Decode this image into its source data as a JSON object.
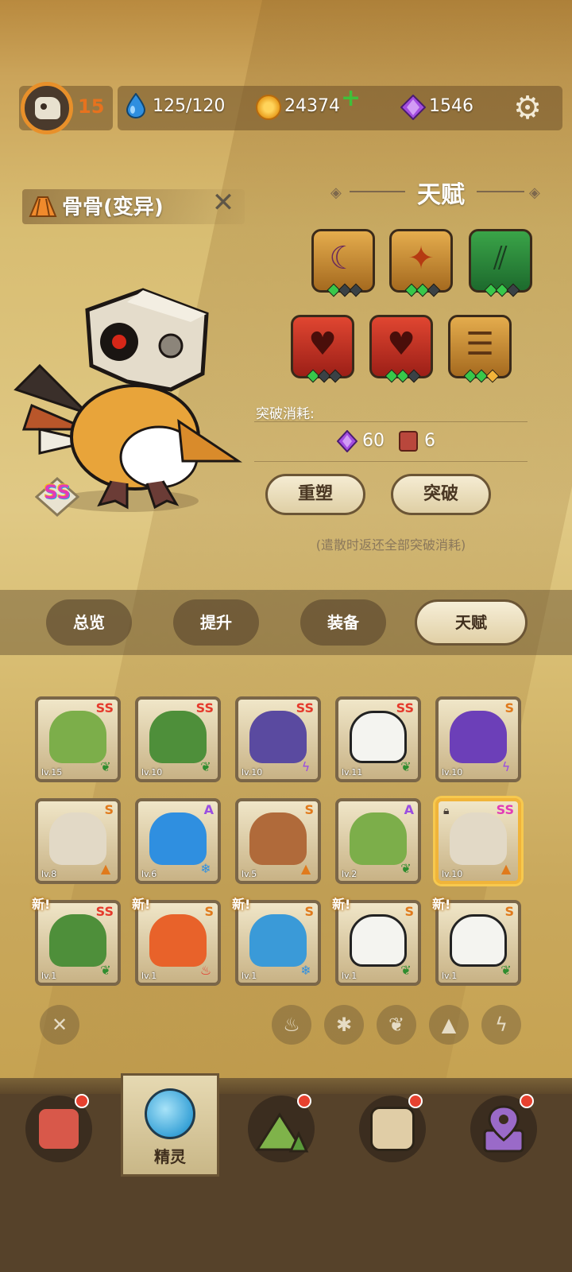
{
  "top_bar": {
    "player_level": "15",
    "energy": "125/120",
    "coins": "24374",
    "gems": "1546"
  },
  "pet": {
    "name": "骨骨(变异)",
    "grade": "SS"
  },
  "talent": {
    "title": "天赋",
    "skills": [
      {
        "color": "gold",
        "icon": "crescent-icon",
        "pips": [
          "on",
          "off",
          "off"
        ]
      },
      {
        "color": "gold",
        "icon": "sparkle-icon",
        "pips": [
          "on",
          "on",
          "off"
        ]
      },
      {
        "color": "green",
        "icon": "claw-icon",
        "pips": [
          "on",
          "on",
          "off"
        ]
      },
      {
        "color": "red",
        "icon": "broken-heart-icon",
        "pips": [
          "on",
          "off",
          "off"
        ]
      },
      {
        "color": "red",
        "icon": "broken-heart-icon",
        "pips": [
          "on",
          "on",
          "off"
        ]
      },
      {
        "color": "gold",
        "icon": "stack-icon",
        "pips": [
          "on",
          "on",
          "gold"
        ]
      }
    ],
    "cost_label": "突破消耗:",
    "cost_gems": "60",
    "cost_books": "6",
    "reshape_button": "重塑",
    "breakthrough_button": "突破",
    "note": "(遣散时返还全部突破消耗)"
  },
  "tabs": [
    {
      "label": "总览",
      "active": false
    },
    {
      "label": "提升",
      "active": false
    },
    {
      "label": "装备",
      "active": false
    },
    {
      "label": "天赋",
      "active": true
    }
  ],
  "pets": [
    {
      "name": "green-dragon",
      "level": "lv.15",
      "grade": "SS",
      "element": "leaf",
      "new": ""
    },
    {
      "name": "cactus",
      "level": "lv.10",
      "grade": "SS",
      "element": "leaf",
      "new": ""
    },
    {
      "name": "crocodile",
      "level": "lv.10",
      "grade": "SS",
      "element": "lightning",
      "new": ""
    },
    {
      "name": "panda",
      "level": "lv.11",
      "grade": "SS",
      "element": "leaf",
      "new": ""
    },
    {
      "name": "purple-cat",
      "level": "lv.10",
      "grade": "S",
      "element": "lightning",
      "new": ""
    },
    {
      "name": "bone-bird",
      "level": "lv.8",
      "grade": "S",
      "element": "ground",
      "new": ""
    },
    {
      "name": "blue-bird",
      "level": "lv.6",
      "grade": "A",
      "element": "ice",
      "new": ""
    },
    {
      "name": "fox",
      "level": "lv.5",
      "grade": "S",
      "element": "ground",
      "new": ""
    },
    {
      "name": "green-dragon",
      "level": "lv.2",
      "grade": "A",
      "element": "leaf",
      "new": ""
    },
    {
      "name": "bone-bird-selected",
      "level": "lv.10",
      "grade": "SS",
      "element": "ground",
      "new": ""
    },
    {
      "name": "cactus",
      "level": "lv.1",
      "grade": "SS",
      "element": "leaf",
      "new": "新!"
    },
    {
      "name": "lava-blob",
      "level": "lv.1",
      "grade": "S",
      "element": "fire",
      "new": "新!"
    },
    {
      "name": "blue-dragon",
      "level": "lv.1",
      "grade": "S",
      "element": "ice",
      "new": "新!"
    },
    {
      "name": "panda",
      "level": "lv.1",
      "grade": "S",
      "element": "leaf",
      "new": "新!"
    },
    {
      "name": "panda",
      "level": "lv.1",
      "grade": "S",
      "element": "leaf",
      "new": "新!"
    }
  ],
  "filters": [
    "close-icon",
    "fire-icon",
    "ice-icon",
    "leaf-icon",
    "ground-icon",
    "lightning-icon"
  ],
  "nav": {
    "active_label": "精灵",
    "items": [
      "device-icon",
      "spirit-icon",
      "mountain-icon",
      "chest-icon",
      "map-pin-icon"
    ]
  }
}
